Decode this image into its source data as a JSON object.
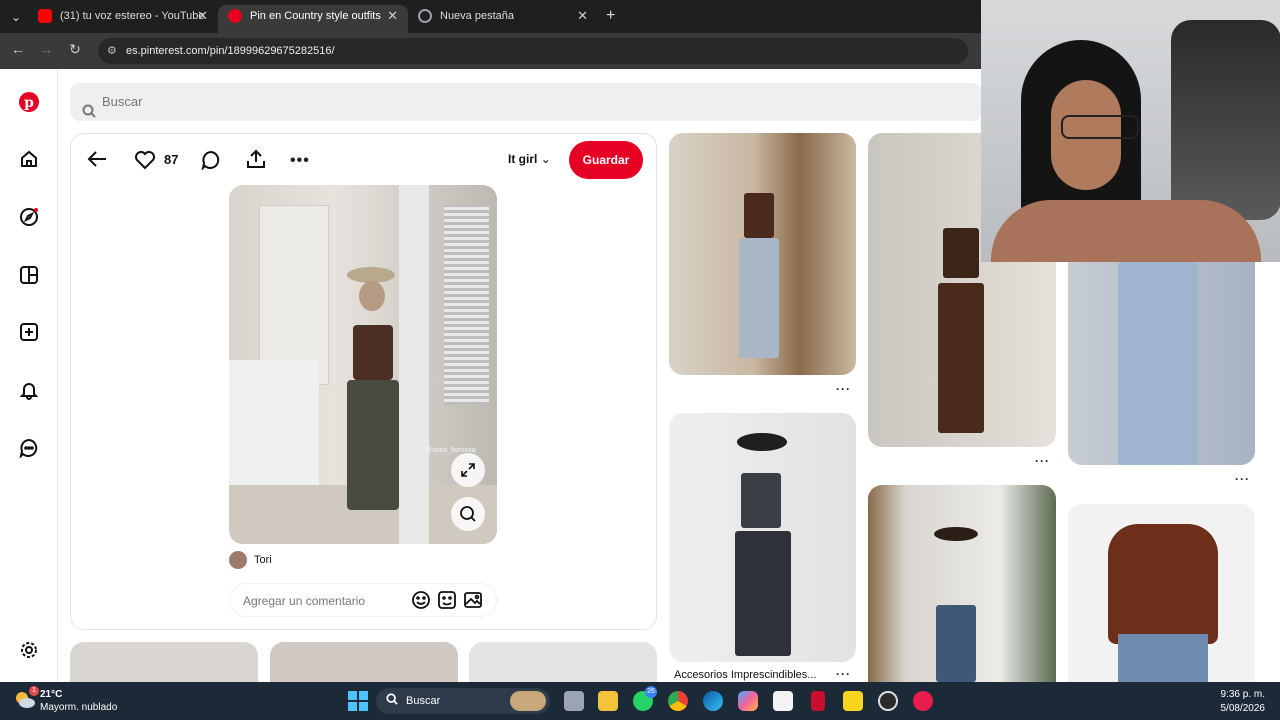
{
  "browser": {
    "tabs": [
      {
        "label": "(31) tu voz estereo - YouTube",
        "color": "#ff0000"
      },
      {
        "label": "Pin en Country style outfits",
        "color": "#e60023"
      },
      {
        "label": "Nueva pestaña",
        "color": "#9aa0a6"
      }
    ],
    "url": "es.pinterest.com/pin/18999629675282516/"
  },
  "search": {
    "placeholder": "Buscar"
  },
  "pin": {
    "likes": "87",
    "board": "It girl",
    "save_label": "Guardar",
    "author": "Tori",
    "comment_placeholder": "Agregar un comentario",
    "watermark": "@sona_llorrisaa"
  },
  "grid": {
    "more": "···",
    "caption": "Accesorios Imprescindibles..."
  },
  "taskbar": {
    "temp": "21°C",
    "weather": "Mayorm. nublado",
    "search": "Buscar",
    "time": "9:36 p. m.",
    "date": "5/08/2026",
    "whatsapp_badge": "26",
    "weather_badge": "1"
  },
  "colors": {
    "brand": "#e60023"
  }
}
